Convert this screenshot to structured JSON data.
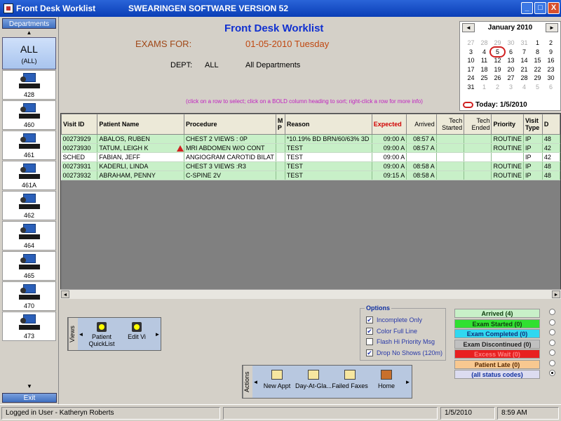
{
  "window": {
    "title": "Front Desk Worklist",
    "software": "SWEARINGEN SOFTWARE VERSION 52",
    "min": "_",
    "max": "□",
    "close": "X"
  },
  "sidebar": {
    "header": "Departments",
    "all_label": "ALL",
    "all_sub": "(ALL)",
    "items": [
      "428",
      "460",
      "461",
      "461A",
      "462",
      "464",
      "465",
      "470",
      "473"
    ],
    "exit": "Exit"
  },
  "header": {
    "title": "Front Desk Worklist",
    "exams_for_label": "EXAMS FOR:",
    "exams_date": "01-05-2010 Tuesday",
    "dept_label": "DEPT:",
    "dept_value": "ALL",
    "dept_name": "All Departments",
    "hint": "(click on a row to select; click on a BOLD column heading to sort; right-click a row for more info)"
  },
  "calendar": {
    "month": "January 2010",
    "prev": "◄",
    "next": "►",
    "days": [
      [
        "27",
        "dim"
      ],
      [
        "28",
        "dim"
      ],
      [
        "29",
        "dim"
      ],
      [
        "30",
        "dim"
      ],
      [
        "31",
        "dim"
      ],
      [
        "1",
        ""
      ],
      [
        "2",
        ""
      ],
      [
        "3",
        ""
      ],
      [
        "4",
        ""
      ],
      [
        "5",
        "today"
      ],
      [
        "6",
        ""
      ],
      [
        "7",
        ""
      ],
      [
        "8",
        ""
      ],
      [
        "9",
        ""
      ],
      [
        "10",
        ""
      ],
      [
        "11",
        ""
      ],
      [
        "12",
        ""
      ],
      [
        "13",
        ""
      ],
      [
        "14",
        ""
      ],
      [
        "15",
        ""
      ],
      [
        "16",
        ""
      ],
      [
        "17",
        ""
      ],
      [
        "18",
        ""
      ],
      [
        "19",
        ""
      ],
      [
        "20",
        ""
      ],
      [
        "21",
        ""
      ],
      [
        "22",
        ""
      ],
      [
        "23",
        ""
      ],
      [
        "24",
        ""
      ],
      [
        "25",
        ""
      ],
      [
        "26",
        ""
      ],
      [
        "27",
        ""
      ],
      [
        "28",
        ""
      ],
      [
        "29",
        ""
      ],
      [
        "30",
        ""
      ],
      [
        "31",
        ""
      ],
      [
        "1",
        "dim"
      ],
      [
        "2",
        "dim"
      ],
      [
        "3",
        "dim"
      ],
      [
        "4",
        "dim"
      ],
      [
        "5",
        "dim"
      ],
      [
        "6",
        "dim"
      ]
    ],
    "today_label": "Today: 1/5/2010"
  },
  "worklist": {
    "columns": [
      "Visit ID",
      "Patient Name",
      "Procedure",
      "M P",
      "Reason",
      "Expected",
      "Arrived",
      "Tech Started",
      "Tech Ended",
      "Priority",
      "Visit Type",
      "D"
    ],
    "rows": [
      {
        "style": "green",
        "warn": false,
        "cells": [
          "00273929",
          "ABALOS, RUBEN",
          "CHEST 2 VIEWS : 0P",
          "",
          "*10.19% BD BRN/60/63% 3D",
          "09:00 A",
          "08:57 A",
          "",
          "",
          "ROUTINE",
          "IP",
          "48"
        ]
      },
      {
        "style": "green",
        "warn": true,
        "cells": [
          "00273930",
          "TATUM, LEIGH K",
          "MRI ABDOMEN W/O CONT",
          "",
          "TEST",
          "09:00 A",
          "08:57 A",
          "",
          "",
          "ROUTINE",
          "IP",
          "42"
        ]
      },
      {
        "style": "white",
        "warn": false,
        "cells": [
          "SCHED",
          "FABIAN, JEFF",
          "ANGIOGRAM CAROTID BILAT",
          "",
          "TEST",
          "09:00 A",
          "",
          "",
          "",
          "",
          "IP",
          "42"
        ]
      },
      {
        "style": "green",
        "warn": false,
        "cells": [
          "00273931",
          "KADERLI, LINDA",
          "CHEST 3 VIEWS :R3",
          "",
          "TEST",
          "09:00 A",
          "08:58 A",
          "",
          "",
          "ROUTINE",
          "IP",
          "48"
        ]
      },
      {
        "style": "green",
        "warn": false,
        "cells": [
          "00273932",
          "ABRAHAM, PENNY",
          "C-SPINE 2V",
          "",
          "TEST",
          "09:15 A",
          "08:58 A",
          "",
          "",
          "ROUTINE",
          "IP",
          "48"
        ]
      }
    ]
  },
  "views": {
    "label": "Views",
    "buttons": [
      "Patient QuickList",
      "Edit Vi"
    ]
  },
  "options": {
    "legend": "Options",
    "items": [
      {
        "label": "Incomplete Only",
        "checked": true
      },
      {
        "label": "Color Full Line",
        "checked": true
      },
      {
        "label": "Flash Hi Priority Msg",
        "checked": false
      },
      {
        "label": "Drop No Shows (120m)",
        "checked": true
      }
    ]
  },
  "status_codes": [
    {
      "label": "Arrived (4)",
      "bg": "#c8f0c8",
      "fg": "#104010"
    },
    {
      "label": "Exam Started (0)",
      "bg": "#30e030",
      "fg": "#104010"
    },
    {
      "label": "Exam Completed (0)",
      "bg": "#30d8f0",
      "fg": "#10307a"
    },
    {
      "label": "Exam Discontinued (0)",
      "bg": "#c0c0c0",
      "fg": "#202020"
    },
    {
      "label": "Excess Wait (0)",
      "bg": "#e82020",
      "fg": "#ff8080"
    },
    {
      "label": "Patient Late (0)",
      "bg": "#f8c890",
      "fg": "#5a2a00"
    },
    {
      "label": "(all status codes)",
      "bg": "#dcdcf0",
      "fg": "#1030a0"
    }
  ],
  "actions": {
    "label": "Actions",
    "buttons": [
      "New Appt",
      "Day-At-Gla...",
      "Failed Faxes",
      "Home"
    ]
  },
  "statusbar": {
    "user": "Logged in User - Katheryn Roberts",
    "date": "1/5/2010",
    "time": "8:59 AM"
  }
}
